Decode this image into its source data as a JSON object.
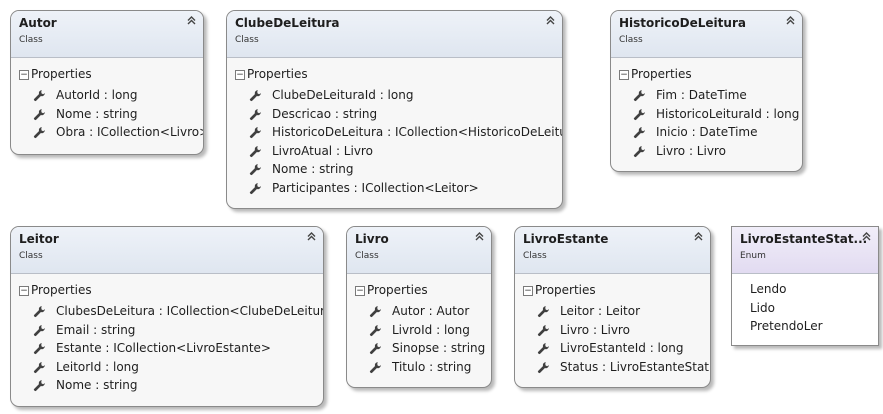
{
  "classes": [
    {
      "title": "Autor",
      "kind": "Class",
      "section": "Properties",
      "properties": [
        "AutorId : long",
        "Nome : string",
        "Obra : ICollection<Livro>"
      ]
    },
    {
      "title": "ClubeDeLeitura",
      "kind": "Class",
      "section": "Properties",
      "properties": [
        "ClubeDeLeituraId : long",
        "Descricao : string",
        "HistoricoDeLeitura : ICollection<HistoricoDeLeitura>",
        "LivroAtual : Livro",
        "Nome : string",
        "Participantes : ICollection<Leitor>"
      ]
    },
    {
      "title": "HistoricoDeLeitura",
      "kind": "Class",
      "section": "Properties",
      "properties": [
        "Fim : DateTime",
        "HistoricoLeituraId : long",
        "Inicio : DateTime",
        "Livro : Livro"
      ]
    },
    {
      "title": "Leitor",
      "kind": "Class",
      "section": "Properties",
      "properties": [
        "ClubesDeLeitura : ICollection<ClubeDeLeitura>",
        "Email : string",
        "Estante : ICollection<LivroEstante>",
        "LeitorId : long",
        "Nome : string"
      ]
    },
    {
      "title": "Livro",
      "kind": "Class",
      "section": "Properties",
      "properties": [
        "Autor : Autor",
        "LivroId : long",
        "Sinopse : string",
        "Titulo : string"
      ]
    },
    {
      "title": "LivroEstante",
      "kind": "Class",
      "section": "Properties",
      "properties": [
        "Leitor : Leitor",
        "Livro : Livro",
        "LivroEstanteId : long",
        "Status : LivroEstanteStatus"
      ]
    }
  ],
  "enum": {
    "title": "LivroEstanteStat...",
    "kind": "Enum",
    "values": [
      "Lendo",
      "Lido",
      "PretendoLer"
    ]
  },
  "icons": {
    "collapse": "double-chevron-up-icon",
    "section_toggle": "minus-box-icon",
    "property": "wrench-icon"
  },
  "colors": {
    "class_header": "#dfe6f0",
    "enum_header": "#e2dbf1",
    "border": "#8a8a8a"
  }
}
